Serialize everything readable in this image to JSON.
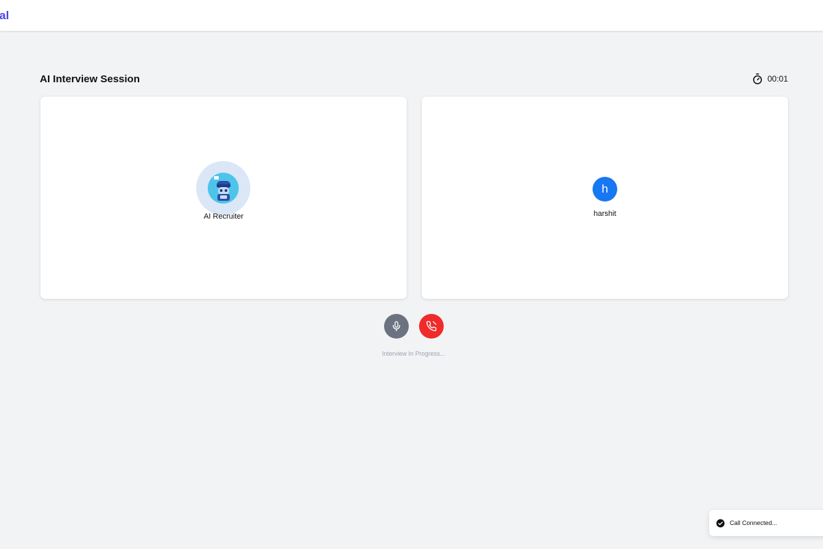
{
  "header": {
    "logo_fragment": "al"
  },
  "session": {
    "title": "AI Interview Session",
    "timer": "00:01"
  },
  "participants": {
    "ai": {
      "name": "AI Recruiter"
    },
    "user": {
      "initial": "h",
      "name": "harshit"
    }
  },
  "controls": {
    "status": "Interview In Progress..."
  },
  "toast": {
    "message": "Call Connected..."
  },
  "colors": {
    "brand": "#4f46e5",
    "mic_button": "#6b7280",
    "hangup_button": "#ef2b2b",
    "user_avatar": "#1877f2",
    "ai_halo": "#dbe7f7"
  }
}
